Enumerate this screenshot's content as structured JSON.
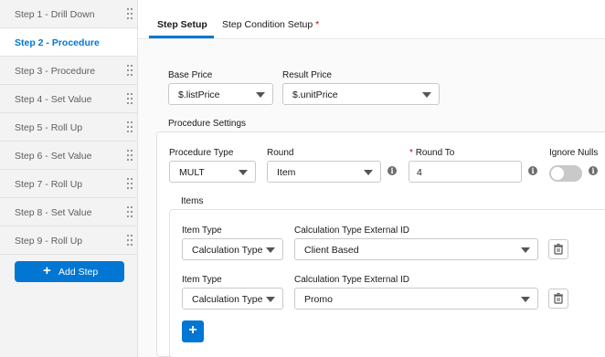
{
  "sidebar": {
    "steps": [
      {
        "label": "Step 1 - Drill Down"
      },
      {
        "label": "Step 2 - Procedure"
      },
      {
        "label": "Step 3 - Procedure"
      },
      {
        "label": "Step 4 - Set Value"
      },
      {
        "label": "Step 5 - Roll Up"
      },
      {
        "label": "Step 6 - Set Value"
      },
      {
        "label": "Step 7 - Roll Up"
      },
      {
        "label": "Step 8 - Set Value"
      },
      {
        "label": "Step 9 - Roll Up"
      }
    ],
    "active_index": 1,
    "add_step_label": "Add Step"
  },
  "tabs": {
    "setup": "Step Setup",
    "condition": "Step Condition Setup",
    "required_marker": "*"
  },
  "prices": {
    "base_label": "Base Price",
    "base_value": "$.listPrice",
    "result_label": "Result Price",
    "result_value": "$.unitPrice"
  },
  "procedure": {
    "section_label": "Procedure Settings",
    "type_label": "Procedure Type",
    "type_value": "MULT",
    "round_label": "Round",
    "round_value": "Item",
    "round_to_required": "*",
    "round_to_label": "Round To",
    "round_to_value": "4",
    "ignore_nulls_label": "Ignore Nulls",
    "ignore_nulls_on": false,
    "info_glyph": "i"
  },
  "items": {
    "section_label": "Items",
    "rows": [
      {
        "item_type_label": "Item Type",
        "item_type_value": "Calculation Type",
        "calc_label": "Calculation Type External ID",
        "calc_value": "Client Based"
      },
      {
        "item_type_label": "Item Type",
        "item_type_value": "Calculation Type",
        "calc_label": "Calculation Type External ID",
        "calc_value": "Promo"
      }
    ],
    "add_glyph": "+"
  },
  "colors": {
    "brand": "#0176d3",
    "required": "#ba0517"
  }
}
